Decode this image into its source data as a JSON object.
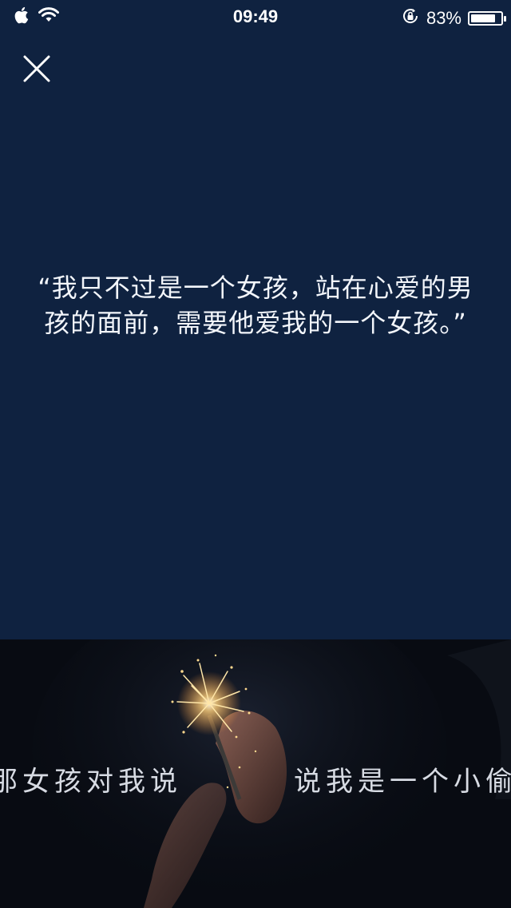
{
  "status_bar": {
    "time": "09:49",
    "battery_percent_label": "83%",
    "battery_level": 0.83,
    "icons": [
      "apple-icon",
      "wifi-icon",
      "rotation-lock-icon",
      "battery-icon"
    ]
  },
  "close": {
    "icon": "close-icon"
  },
  "quote": {
    "text": "“我只不过是一个女孩，站在心爱的男孩的面前，需要他爱我的一个女孩。”"
  },
  "photo": {
    "subtitle_left": "那女孩对我说",
    "subtitle_right": "说我是一个小偷"
  },
  "colors": {
    "background": "#0f2240",
    "photo_background": "#080b12",
    "text": "#ffffff"
  }
}
